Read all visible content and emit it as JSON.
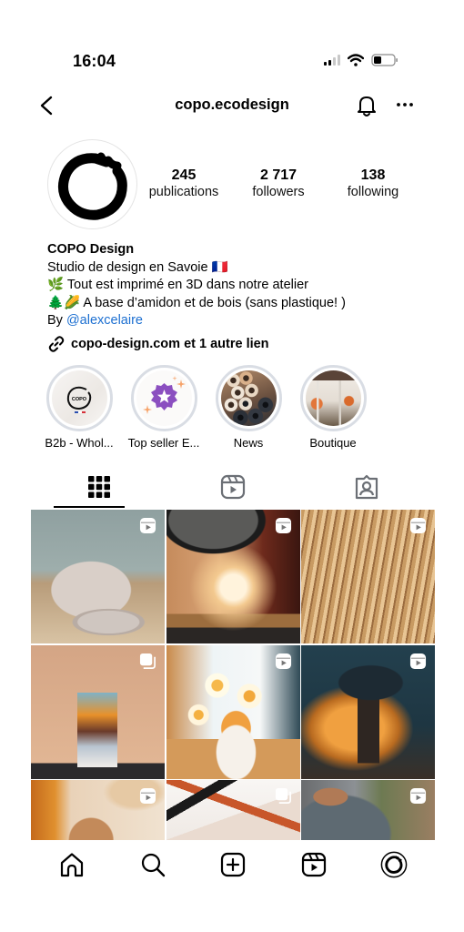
{
  "status_bar": {
    "time": "16:04",
    "icons": [
      "cellular-signal-icon",
      "wifi-icon",
      "battery-icon"
    ],
    "signal_bars_active": 2,
    "signal_bars_total": 4,
    "battery_level_percent": 30
  },
  "header": {
    "username": "copo.ecodesign",
    "back_icon": "chevron-left-icon",
    "notifications_icon": "bell-icon",
    "more_icon": "more-horizontal-icon"
  },
  "profile": {
    "avatar_icon": "copo-logo-icon",
    "stats": [
      {
        "value": "245",
        "label": "publications"
      },
      {
        "value": "2 717",
        "label": "followers"
      },
      {
        "value": "138",
        "label": "following"
      }
    ],
    "display_name": "COPO Design",
    "bio_lines": [
      "Studio de design en Savoie 🇫🇷",
      "🌿 Tout est imprimé en 3D dans notre atelier",
      "🌲🌽 A base d’amidon et de bois (sans plastique! )"
    ],
    "by_prefix": "By ",
    "mention": "@alexcelaire",
    "link_text": "copo-design.com et 1 autre lien",
    "link_icon": "link-icon"
  },
  "highlights": [
    {
      "label": "B2b - Whol...",
      "cover": "copo-logo-cover"
    },
    {
      "label": "Top seller E...",
      "cover": "star-badge-cover"
    },
    {
      "label": "News",
      "cover": "spools-photo"
    },
    {
      "label": "Boutique",
      "cover": "shop-front-photo"
    }
  ],
  "tabs": [
    {
      "name": "posts",
      "icon": "grid-icon",
      "active": true
    },
    {
      "name": "reels",
      "icon": "reels-icon",
      "active": false
    },
    {
      "name": "tagged",
      "icon": "tagged-user-icon",
      "active": false
    }
  ],
  "grid_posts": [
    {
      "subject": "textured pot and tray",
      "type": "reel",
      "badge_icon": "reel-icon"
    },
    {
      "subject": "glowing table lamp by mirror",
      "type": "reel",
      "badge_icon": "reel-icon"
    },
    {
      "subject": "wavy wood panel",
      "type": "reel",
      "badge_icon": "reel-icon"
    },
    {
      "subject": "gradient vase with dried palm",
      "type": "carousel",
      "badge_icon": "carousel-icon"
    },
    {
      "subject": "daffodils in vase",
      "type": "reel",
      "badge_icon": "reel-icon"
    },
    {
      "subject": "dark lamp with warm light",
      "type": "reel",
      "badge_icon": "reel-icon"
    },
    {
      "subject": "wooden vase with pampas",
      "type": "reel",
      "badge_icon": "reel-icon"
    },
    {
      "subject": "paper and orange shapes",
      "type": "carousel",
      "badge_icon": "carousel-icon"
    },
    {
      "subject": "man in workshop",
      "type": "reel",
      "badge_icon": "reel-icon"
    }
  ],
  "bottom_nav": [
    {
      "name": "home",
      "icon": "home-icon"
    },
    {
      "name": "search",
      "icon": "search-icon"
    },
    {
      "name": "create",
      "icon": "plus-square-icon"
    },
    {
      "name": "reels",
      "icon": "reels-icon"
    },
    {
      "name": "profile",
      "icon": "profile-avatar-icon"
    }
  ],
  "colors": {
    "link_blue": "#1c6fd1",
    "highlight_ring": "#d9dde4",
    "text": "#000000"
  }
}
